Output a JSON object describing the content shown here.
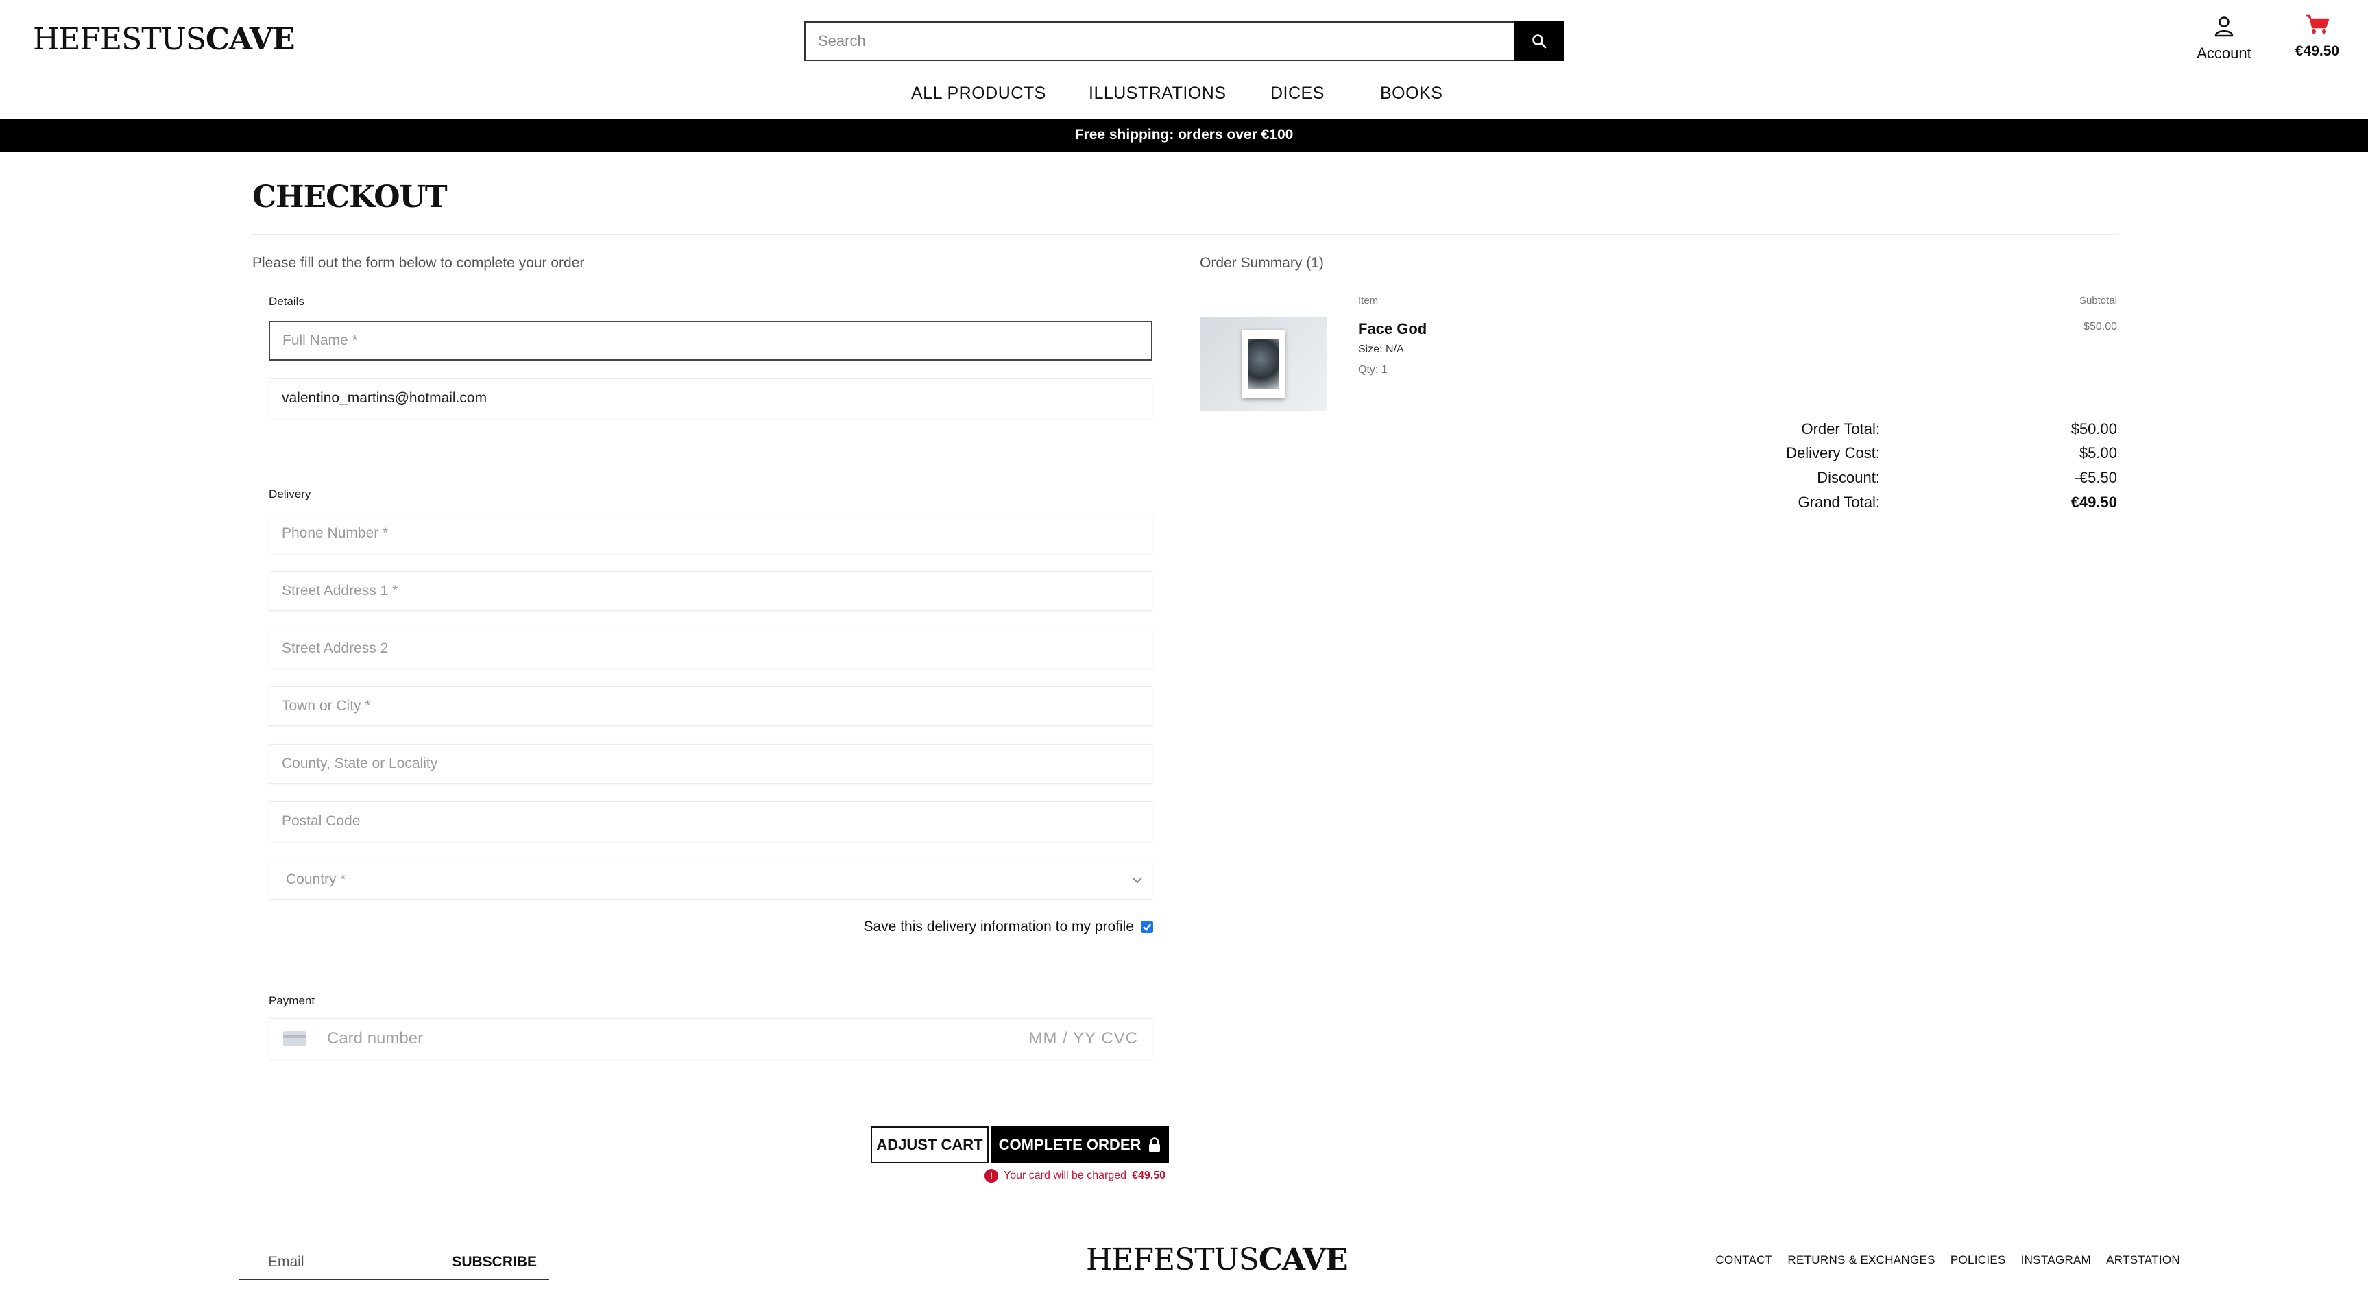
{
  "header": {
    "logo_text_1": "HEFESTUS",
    "logo_text_2": "CAVE",
    "search_placeholder": "Search",
    "account_label": "Account",
    "cart_total": "€49.50",
    "cart_color": "#e0202a"
  },
  "nav": {
    "items": [
      "ALL PRODUCTS",
      "ILLUSTRATIONS",
      "DICES",
      "BOOKS"
    ]
  },
  "banner": {
    "text": "Free shipping: orders over €100"
  },
  "checkout": {
    "title": "CHECKOUT",
    "intro": "Please fill out the form below to complete your order",
    "details_label": "Details",
    "full_name_placeholder": "Full Name *",
    "email_value": "valentino_martins@hotmail.com",
    "delivery_label": "Delivery",
    "phone_placeholder": "Phone Number *",
    "street1_placeholder": "Street Address 1 *",
    "street2_placeholder": "Street Address 2",
    "town_placeholder": "Town or City *",
    "county_placeholder": "County, State or Locality",
    "postal_placeholder": "Postal Code",
    "country_placeholder": "Country *",
    "save_info_label": "Save this delivery information to my profile",
    "save_info_checked": true,
    "payment_label": "Payment",
    "card_placeholder": "Card number",
    "card_expiry_cvc": "MM / YY  CVC",
    "adjust_cart_label": "ADJUST CART",
    "complete_order_label": "COMPLETE ORDER",
    "charge_note": "Your card will be charged",
    "charge_amount": "€49.50",
    "error_color": "#c8102e"
  },
  "summary": {
    "title": "Order Summary (1)",
    "col_item": "Item",
    "col_subtotal": "Subtotal",
    "item": {
      "name": "Face God",
      "size": "Size: N/A",
      "qty": "Qty: 1",
      "price": "$50.00"
    },
    "totals": [
      {
        "label": "Order Total:",
        "value": "$50.00"
      },
      {
        "label": "Delivery Cost:",
        "value": "$5.00"
      },
      {
        "label": "Discount:",
        "value": "-€5.50"
      },
      {
        "label": "Grand Total:",
        "value": "€49.50"
      }
    ]
  },
  "footer": {
    "email_placeholder": "Email",
    "subscribe_label": "SUBSCRIBE",
    "links": [
      "CONTACT",
      "RETURNS & EXCHANGES",
      "POLICIES",
      "INSTAGRAM",
      "ARTSTATION"
    ]
  }
}
